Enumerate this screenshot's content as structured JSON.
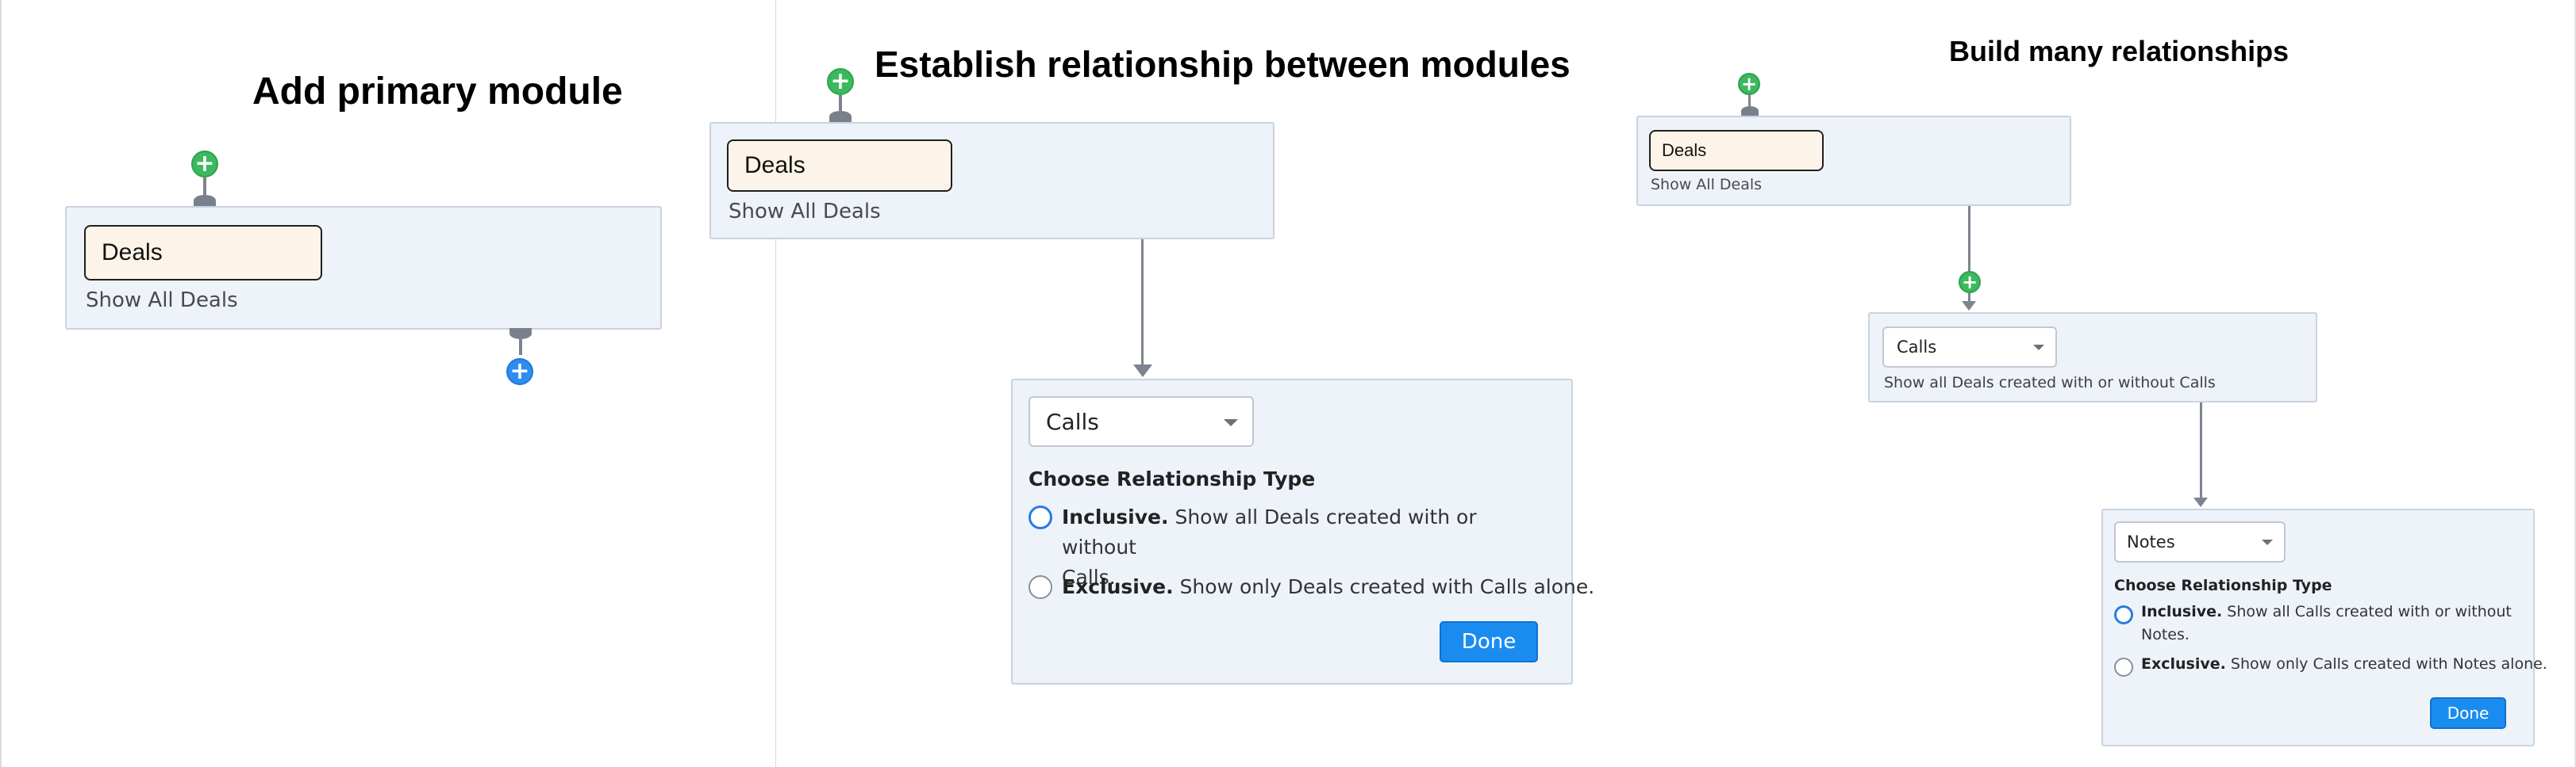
{
  "panels": [
    {
      "title": "Add primary module",
      "module": {
        "name": "Deals",
        "caption": "Show All Deals"
      }
    },
    {
      "title": "Establish relationship between modules",
      "module": {
        "name": "Deals",
        "caption": "Show All Deals"
      },
      "relationship": {
        "selected_module": "Calls",
        "heading": "Choose Relationship Type",
        "options": [
          {
            "label": "Inclusive.",
            "description": "Show all Deals created with or without",
            "description_cont": "Calls.",
            "selected": true
          },
          {
            "label": "Exclusive.",
            "description": "Show only Deals created with Calls alone.",
            "selected": false
          }
        ],
        "done_label": "Done"
      }
    },
    {
      "title": "Build many relationships",
      "module": {
        "name": "Deals",
        "caption": "Show All Deals"
      },
      "second": {
        "selected_module": "Calls",
        "caption": "Show all Deals created with or without Calls"
      },
      "relationship": {
        "selected_module": "Notes",
        "heading": "Choose Relationship Type",
        "options": [
          {
            "label": "Inclusive.",
            "description": "Show all Calls created with or without",
            "description_cont": "Notes.",
            "selected": true
          },
          {
            "label": "Exclusive.",
            "description": "Show only Calls created with Notes alone.",
            "selected": false
          }
        ],
        "done_label": "Done"
      }
    }
  ],
  "colors": {
    "accent_blue": "#1a8cf0",
    "add_green": "#3cb95f",
    "box_fill": "#eef3fa",
    "pill_fill": "#fcf4e8",
    "connector": "#7d8390"
  },
  "icons": [
    "plus-icon",
    "chevron-down-icon",
    "radio-icon"
  ]
}
